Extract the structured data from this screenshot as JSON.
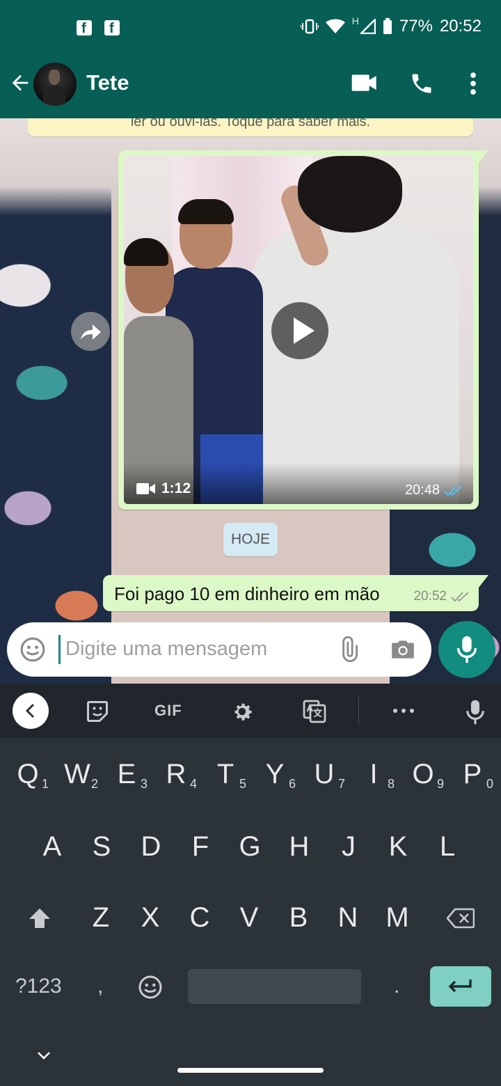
{
  "status_bar": {
    "battery": "77%",
    "time": "20:52",
    "network_letter": "H"
  },
  "header": {
    "contact_name": "Tete"
  },
  "chat": {
    "notice_text": "ler ou ouvi-las. Toque para saber mais.",
    "video_message": {
      "duration": "1:12",
      "time": "20:48"
    },
    "date_chip": "HOJE",
    "text_message": {
      "text": "Foi pago 10 em dinheiro em mão",
      "time": "20:52"
    }
  },
  "composer": {
    "placeholder": "Digite uma mensagem"
  },
  "keyboard": {
    "toolbar_gif": "GIF",
    "row1": [
      {
        "key": "Q",
        "hint": "1"
      },
      {
        "key": "W",
        "hint": "2"
      },
      {
        "key": "E",
        "hint": "3"
      },
      {
        "key": "R",
        "hint": "4"
      },
      {
        "key": "T",
        "hint": "5"
      },
      {
        "key": "Y",
        "hint": "6"
      },
      {
        "key": "U",
        "hint": "7"
      },
      {
        "key": "I",
        "hint": "8"
      },
      {
        "key": "O",
        "hint": "9"
      },
      {
        "key": "P",
        "hint": "0"
      }
    ],
    "row2": [
      "A",
      "S",
      "D",
      "F",
      "G",
      "H",
      "J",
      "K",
      "L"
    ],
    "row3": [
      "Z",
      "X",
      "C",
      "V",
      "B",
      "N",
      "M"
    ],
    "symbols_key": "?123",
    "comma_key": ",",
    "period_key": "."
  },
  "colors": {
    "header": "#075e54",
    "accent": "#128c7e",
    "bubble_out": "#dcf8c6",
    "ticks_read": "#4fc3f7",
    "ticks_sent": "#9e9e9e"
  }
}
